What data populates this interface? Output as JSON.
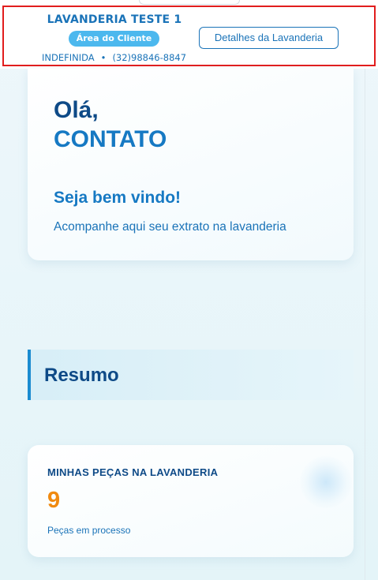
{
  "header": {
    "laundry_name": "LAVANDERIA TESTE 1",
    "area_badge": "Área do Cliente",
    "location": "INDEFINIDA",
    "separator": "•",
    "phone": "(32)98846-8847",
    "details_button": "Detalhes da Lavanderia"
  },
  "welcome": {
    "greeting": "Olá,",
    "name": "CONTATO",
    "heading": "Seja bem vindo!",
    "subtitle": "Acompanhe aqui seu extrato na lavanderia"
  },
  "summary": {
    "title": "Resumo"
  },
  "stat_card": {
    "label": "MINHAS PEÇAS NA LAVANDERIA",
    "value": "9",
    "description": "Peças em processo"
  },
  "colors": {
    "primary": "#1a73b8",
    "dark": "#0e4a87",
    "accent_badge": "#4cb8ee",
    "value_orange": "#f08a10",
    "highlight_border": "#e11d1d"
  }
}
